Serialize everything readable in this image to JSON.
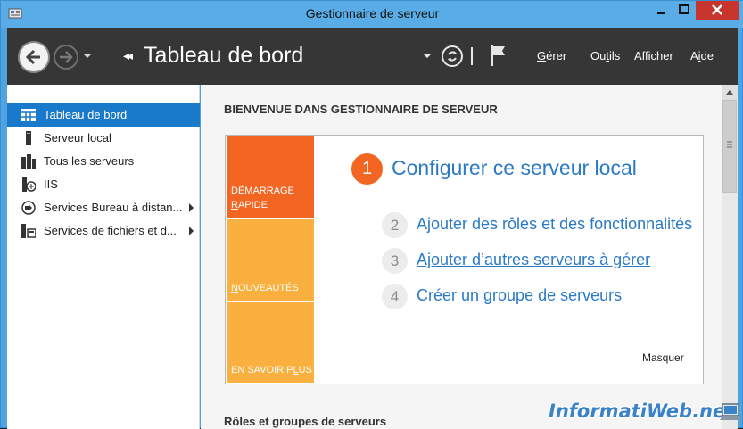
{
  "window": {
    "title": "Gestionnaire de serveur"
  },
  "toolbar": {
    "breadcrumb_arrow": "◂◂",
    "page_title": "Tableau de bord",
    "menus": [
      {
        "label": "Gérer",
        "underline": "G",
        "rest": "érer"
      },
      {
        "label": "Outils",
        "underline": "O",
        "rest": "utils"
      },
      {
        "label": "Afficher",
        "underline": "A",
        "rest": "fficher"
      },
      {
        "label": "Aide",
        "underline": "A",
        "rest": "ide"
      }
    ]
  },
  "sidebar": {
    "items": [
      {
        "label": "Tableau de bord",
        "icon": "dashboard-grid-icon",
        "active": true
      },
      {
        "label": "Serveur local",
        "icon": "server-icon"
      },
      {
        "label": "Tous les serveurs",
        "icon": "servers-icon"
      },
      {
        "label": "IIS",
        "icon": "iis-icon"
      },
      {
        "label": "Services Bureau à distan...",
        "icon": "remote-desktop-icon",
        "expandable": true
      },
      {
        "label": "Services de fichiers et d...",
        "icon": "file-services-icon",
        "expandable": true
      }
    ]
  },
  "main": {
    "welcome_heading": "BIENVENUE DANS GESTIONNAIRE DE SERVEUR",
    "tiles": [
      {
        "line1": "DÉMARRAGE",
        "line2_underline": "R",
        "line2_rest": "APIDE"
      },
      {
        "line1_underline": "N",
        "line1_rest": "OUVEAUTÉS"
      },
      {
        "line1_pre": "EN SAVOIR P",
        "line1_underline": "L",
        "line1_post": "US"
      }
    ],
    "step1": {
      "number": "1",
      "label": "Configurer ce serveur local"
    },
    "steps": [
      {
        "number": "2",
        "label": "Ajouter des rôles et des fonctionnalités"
      },
      {
        "number": "3",
        "label": "Ajouter d’autres serveurs à gérer"
      },
      {
        "number": "4",
        "label": "Créer un groupe de serveurs"
      }
    ],
    "hide_label": "Masquer",
    "roles_heading": "Rôles et groupes de serveurs"
  },
  "watermark": "InformatiWeb.net",
  "colors": {
    "accent_orange": "#f26522",
    "tile_yellow": "#f9b03e",
    "link_blue": "#2a7ac6",
    "active_blue": "#1979ca",
    "toolbar_dark": "#363636",
    "titlebar_blue": "#5aace6"
  }
}
